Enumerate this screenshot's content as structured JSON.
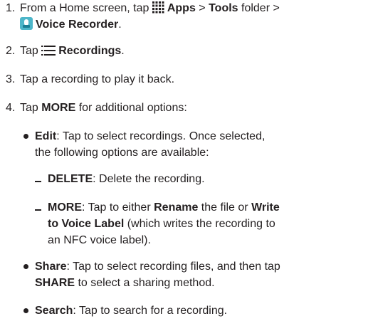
{
  "steps": [
    {
      "number": "1.",
      "line1": {
        "prefix": "From a Home screen, tap ",
        "apps": "Apps",
        "sep1": " > ",
        "tools": "Tools",
        "sep2": " folder >"
      },
      "line2": {
        "voice_recorder": "Voice Recorder",
        "suffix": "."
      },
      "icons": [
        "apps-grid-icon",
        "voice-recorder-app-icon"
      ]
    },
    {
      "number": "2.",
      "prefix": "Tap ",
      "recordings": "Recordings",
      "suffix": ".",
      "icon": "list-icon"
    },
    {
      "number": "3.",
      "text": "Tap a recording to play it back."
    },
    {
      "number": "4.",
      "prefix": "Tap ",
      "more": "MORE",
      "suffix": " for additional options:"
    }
  ],
  "options": {
    "edit": {
      "term": "Edit",
      "line1": ": Tap to select recordings. Once selected,",
      "line2": "the following options are available:",
      "sub": {
        "delete": {
          "term": "DELETE",
          "text": ": Delete the recording."
        },
        "more": {
          "term": "MORE",
          "line1_text": ": Tap to either ",
          "rename": "Rename",
          "line1_mid": " the file or ",
          "write": "Write",
          "line2_bold": "to Voice Label",
          "line2_text": " (which writes the recording to",
          "line3": "an NFC voice label)."
        }
      }
    },
    "share": {
      "term": "Share",
      "line1": ": Tap to select recording files, and then tap",
      "line2_bold": "SHARE",
      "line2_text": " to select a sharing method."
    },
    "search": {
      "term": "Search",
      "text": ": Tap to search for a recording."
    }
  },
  "colors": {
    "text": "#231f20",
    "app_icon_bg": "#4db6c9",
    "app_icon_fg": "#1b7f95"
  }
}
